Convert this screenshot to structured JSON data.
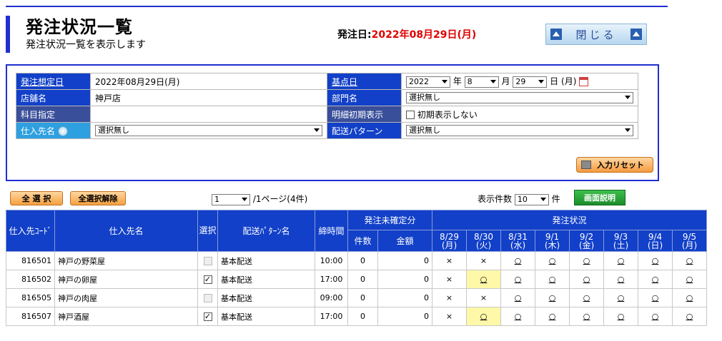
{
  "header": {
    "title": "発注状況一覧",
    "subtitle": "発注状況一覧を表示します",
    "order_date_label": "発注日:",
    "order_date_value": "2022年08月29日(月)",
    "close_button": "閉じる"
  },
  "conditions": {
    "planned_date_label": "発注想定日",
    "planned_date_value": "2022年08月29日(月)",
    "base_date_label": "基点日",
    "base_year": "2022",
    "year_suffix": "年",
    "base_month": "8",
    "month_suffix": "月",
    "base_day": "29",
    "day_suffix": "日",
    "base_weekday": "(月)",
    "store_label": "店舗名",
    "store_value": "神戸店",
    "department_label": "部門名",
    "department_value": "選択無し",
    "subject_label": "科目指定",
    "detail_label": "明細初期表示",
    "detail_checkbox_label": "初期表示しない",
    "supplier_label": "仕入先名",
    "supplier_value": "選択無し",
    "delivery_pattern_label": "配送パターン",
    "delivery_pattern_value": "選択無し",
    "reset_button": "入力リセット"
  },
  "toolbar": {
    "select_all": "全 選 択",
    "deselect_all": "全選択解除",
    "page_value": "1",
    "page_suffix": "/1ページ(4件)",
    "display_count_label": "表示件数",
    "display_count_value": "10",
    "display_count_suffix": "件",
    "help_button": "画面説明"
  },
  "table": {
    "col_supplier_code": "仕入先ｺｰﾄﾞ",
    "col_supplier_name": "仕入先名",
    "col_select": "選択",
    "col_delivery_pattern": "配送ﾊﾟﾀｰﾝ名",
    "col_deadline": "締時間",
    "col_unconfirmed": "発注未確定分",
    "col_count": "件数",
    "col_amount": "金額",
    "col_order_status": "発注状況",
    "dates": [
      {
        "date": "8/29",
        "dow": "(月)"
      },
      {
        "date": "8/30",
        "dow": "(火)"
      },
      {
        "date": "8/31",
        "dow": "(水)"
      },
      {
        "date": "9/1",
        "dow": "(木)"
      },
      {
        "date": "9/2",
        "dow": "(金)"
      },
      {
        "date": "9/3",
        "dow": "(土)"
      },
      {
        "date": "9/4",
        "dow": "(日)"
      },
      {
        "date": "9/5",
        "dow": "(月)"
      }
    ],
    "rows": [
      {
        "code": "816501",
        "name": "神戸の野菜屋",
        "checked": false,
        "pattern": "基本配送",
        "deadline": "10:00",
        "count": "0",
        "amount": "0",
        "status": [
          "×",
          "×",
          "○",
          "○",
          "○",
          "○",
          "○",
          "○"
        ],
        "highlight": [
          false,
          false,
          false,
          false,
          false,
          false,
          false,
          false
        ]
      },
      {
        "code": "816502",
        "name": "神戸の卵屋",
        "checked": true,
        "pattern": "基本配送",
        "deadline": "17:00",
        "count": "0",
        "amount": "0",
        "status": [
          "×",
          "○",
          "○",
          "○",
          "○",
          "○",
          "○",
          "○"
        ],
        "highlight": [
          false,
          true,
          false,
          false,
          false,
          false,
          false,
          false
        ]
      },
      {
        "code": "816505",
        "name": "神戸の肉屋",
        "checked": false,
        "pattern": "基本配送",
        "deadline": "09:00",
        "count": "0",
        "amount": "0",
        "status": [
          "×",
          "×",
          "○",
          "○",
          "○",
          "○",
          "○",
          "○"
        ],
        "highlight": [
          false,
          false,
          false,
          false,
          false,
          false,
          false,
          false
        ]
      },
      {
        "code": "816507",
        "name": "神戸酒屋",
        "checked": true,
        "pattern": "基本配送",
        "deadline": "17:00",
        "count": "0",
        "amount": "0",
        "status": [
          "×",
          "○",
          "○",
          "○",
          "○",
          "○",
          "○",
          "○"
        ],
        "highlight": [
          false,
          true,
          false,
          false,
          false,
          false,
          false,
          false
        ]
      }
    ]
  }
}
